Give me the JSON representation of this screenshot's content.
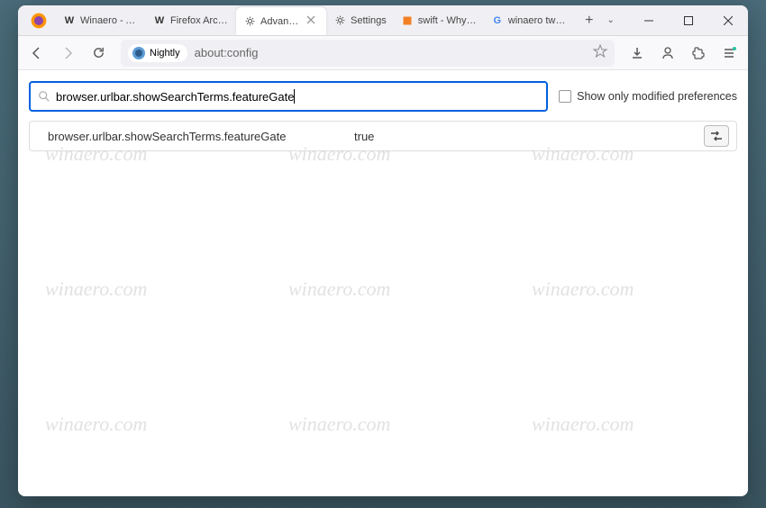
{
  "tabs": [
    {
      "label": "Winaero - At th",
      "icon": "W"
    },
    {
      "label": "Firefox Archive",
      "icon": "W"
    },
    {
      "label": "Advanced Pr",
      "icon": "gear",
      "active": true
    },
    {
      "label": "Settings",
      "icon": "gear"
    },
    {
      "label": "swift - Why is a",
      "icon": "stack"
    },
    {
      "label": "winaero tweake",
      "icon": "G"
    }
  ],
  "identity_label": "Nightly",
  "url": "about:config",
  "search_value": "browser.urlbar.showSearchTerms.featureGate",
  "checkbox_label": "Show only modified preferences",
  "pref": {
    "name": "browser.urlbar.showSearchTerms.featureGate",
    "value": "true"
  },
  "watermark_text": "winaero.com"
}
